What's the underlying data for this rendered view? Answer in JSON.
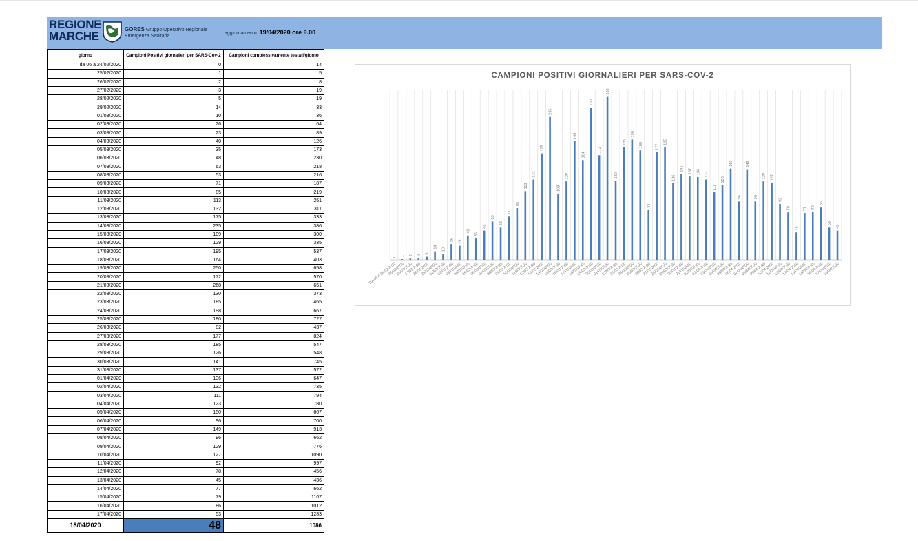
{
  "header": {
    "logo_line1": "REGIONE",
    "logo_line2": "MARCHE",
    "gores_bold": "GORES",
    "gores_text1": "Gruppo Operativo Regionale",
    "gores_text2": "Emergenza Sanitaria",
    "update_label": "aggiornamento:",
    "update_value": "19/04/2020 ore 9.00"
  },
  "table": {
    "columns": [
      "giorno",
      "Campioni Positivi giornalieri per SARS-Cov-2",
      "Campioni complessivamente testati/giorno"
    ],
    "rows": [
      [
        "da 06 a 24/02/2020",
        "0",
        "14"
      ],
      [
        "25/02/2020",
        "1",
        "5"
      ],
      [
        "26/02/2020",
        "2",
        "8"
      ],
      [
        "27/02/2020",
        "3",
        "19"
      ],
      [
        "28/02/2020",
        "5",
        "19"
      ],
      [
        "29/02/2020",
        "14",
        "33"
      ],
      [
        "01/03/2020",
        "10",
        "36"
      ],
      [
        "02/03/2020",
        "26",
        "64"
      ],
      [
        "03/03/2020",
        "23",
        "89"
      ],
      [
        "04/03/2020",
        "40",
        "126"
      ],
      [
        "05/03/2020",
        "35",
        "173"
      ],
      [
        "06/03/2020",
        "48",
        "230"
      ],
      [
        "07/03/2020",
        "63",
        "218"
      ],
      [
        "08/03/2020",
        "53",
        "216"
      ],
      [
        "09/03/2020",
        "71",
        "187"
      ],
      [
        "10/03/2020",
        "85",
        "219"
      ],
      [
        "11/03/2020",
        "113",
        "251"
      ],
      [
        "12/03/2020",
        "132",
        "311"
      ],
      [
        "13/03/2020",
        "175",
        "333"
      ],
      [
        "14/03/2020",
        "235",
        "386"
      ],
      [
        "15/03/2020",
        "109",
        "300"
      ],
      [
        "16/03/2020",
        "129",
        "335"
      ],
      [
        "17/03/2020",
        "195",
        "537"
      ],
      [
        "18/03/2020",
        "164",
        "403"
      ],
      [
        "19/03/2020",
        "250",
        "658"
      ],
      [
        "20/03/2020",
        "172",
        "570"
      ],
      [
        "21/03/2020",
        "268",
        "651"
      ],
      [
        "22/03/2020",
        "130",
        "373"
      ],
      [
        "23/03/2020",
        "185",
        "465"
      ],
      [
        "24/03/2020",
        "198",
        "667"
      ],
      [
        "25/03/2020",
        "180",
        "727"
      ],
      [
        "26/03/2020",
        "82",
        "437"
      ],
      [
        "27/03/2020",
        "177",
        "824"
      ],
      [
        "28/03/2020",
        "185",
        "547"
      ],
      [
        "29/03/2020",
        "126",
        "548"
      ],
      [
        "30/03/2020",
        "141",
        "745"
      ],
      [
        "31/03/2020",
        "137",
        "572"
      ],
      [
        "01/04/2020",
        "136",
        "647"
      ],
      [
        "02/04/2020",
        "132",
        "735"
      ],
      [
        "03/04/2020",
        "111",
        "794"
      ],
      [
        "04/04/2020",
        "123",
        "780"
      ],
      [
        "05/04/2020",
        "150",
        "667"
      ],
      [
        "06/04/2020",
        "96",
        "700"
      ],
      [
        "07/04/2020",
        "149",
        "913"
      ],
      [
        "08/04/2020",
        "96",
        "662"
      ],
      [
        "09/04/2020",
        "129",
        "776"
      ],
      [
        "10/04/2020",
        "127",
        "1090"
      ],
      [
        "11/04/2020",
        "92",
        "997"
      ],
      [
        "12/04/2020",
        "78",
        "456"
      ],
      [
        "13/04/2020",
        "45",
        "436"
      ],
      [
        "14/04/2020",
        "77",
        "662"
      ],
      [
        "15/04/2020",
        "79",
        "1107"
      ],
      [
        "16/04/2020",
        "86",
        "1012"
      ],
      [
        "17/04/2020",
        "53",
        "1283"
      ]
    ],
    "total_row": [
      "18/04/2020",
      "48",
      "1086"
    ]
  },
  "colors": {
    "header_bg": "#8eb4e3",
    "bar": "#4a7ebb",
    "highlight_cell": "#4a7ebb",
    "title": "#595959"
  },
  "chart_data": {
    "type": "bar",
    "title": "CAMPIONI POSITIVI GIORNALIERI PER SARS-COV-2",
    "xlabel": "",
    "ylabel": "",
    "grid": "vertical",
    "categories": [
      "DA 06 A 24/02/2020",
      "25/02/2020",
      "26/02/2020",
      "27/02/2020",
      "28/02/2020",
      "29/02/2020",
      "01/03/2020",
      "02/03/2020",
      "03/03/2020",
      "04/03/2020",
      "05/03/2020",
      "06/03/2020",
      "07/03/2020",
      "08/03/2020",
      "09/03/2020",
      "10/03/2020",
      "11/03/2020",
      "12/03/2020",
      "13/03/2020",
      "14/03/2020",
      "15/03/2020",
      "16/03/2020",
      "17/03/2020",
      "18/03/2020",
      "19/03/2020",
      "20/03/2020",
      "21/03/2020",
      "22/03/2020",
      "23/03/2020",
      "24/03/2020",
      "25/03/2020",
      "26/03/2020",
      "27/03/2020",
      "28/03/2020",
      "29/03/2020",
      "30/03/2020",
      "31/03/2020",
      "01/04/2020",
      "02/04/2020",
      "03/04/2020",
      "04/04/2020",
      "05/04/2020",
      "06/04/2020",
      "07/04/2020",
      "08/04/2020",
      "09/04/2020",
      "10/04/2020",
      "11/04/2020",
      "12/04/2020",
      "13/04/2020",
      "14/04/2020",
      "15/04/2020",
      "16/04/2020",
      "17/04/2020",
      "18/04/2020"
    ],
    "values": [
      0,
      1,
      2,
      3,
      5,
      14,
      10,
      26,
      23,
      40,
      35,
      48,
      63,
      53,
      71,
      85,
      113,
      132,
      175,
      235,
      109,
      129,
      195,
      164,
      250,
      172,
      268,
      130,
      185,
      198,
      180,
      82,
      177,
      185,
      126,
      141,
      137,
      136,
      132,
      111,
      123,
      150,
      96,
      149,
      96,
      129,
      127,
      92,
      78,
      45,
      77,
      79,
      86,
      53,
      48
    ],
    "ylim": [
      0,
      280
    ]
  }
}
